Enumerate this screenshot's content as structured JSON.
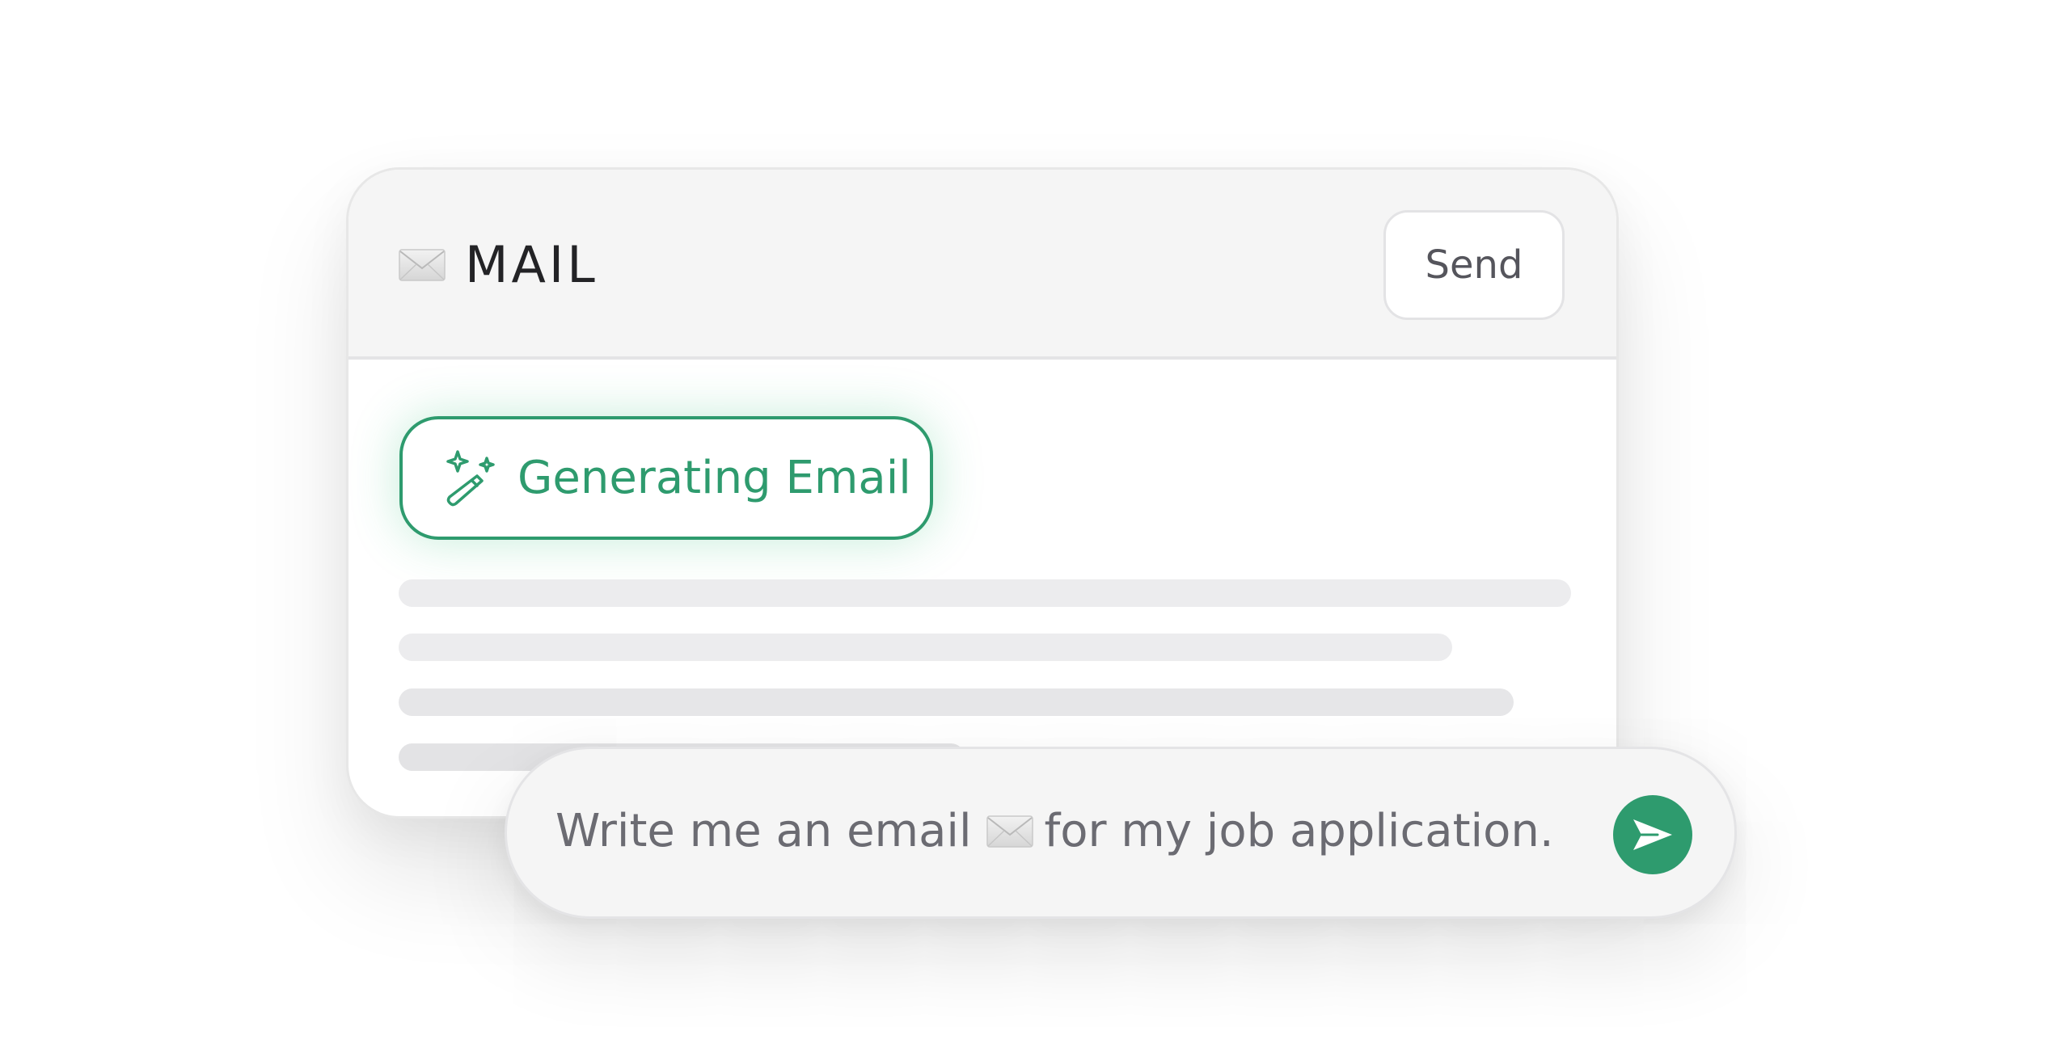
{
  "mail_window": {
    "title": "MAIL",
    "title_icon": "envelope-icon",
    "send_label": "Send"
  },
  "generating": {
    "label": "Generating Email",
    "icon": "magic-wand-icon"
  },
  "prompt": {
    "text_before": "Write me an email",
    "inline_icon": "envelope-icon",
    "text_after": "for my job application.",
    "submit_icon": "send-arrow-icon"
  },
  "colors": {
    "accent": "#2e9b6e",
    "background": "#ffffff",
    "header": "#f5f5f5",
    "skeleton": "#ececee",
    "prompt_text": "#6b6b72"
  }
}
